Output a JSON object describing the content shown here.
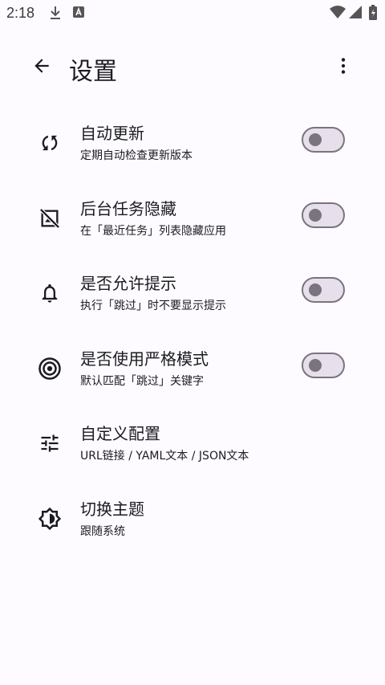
{
  "status_bar": {
    "time": "2:18",
    "icons": [
      "download-icon",
      "app-notification-icon",
      "wifi-icon",
      "signal-icon",
      "battery-icon"
    ]
  },
  "app_bar": {
    "title": "设置",
    "back_icon": "arrow-back-icon",
    "menu_icon": "more-vert-icon"
  },
  "settings": [
    {
      "title": "自动更新",
      "subtitle": "定期自动检查更新版本",
      "icon": "sync-icon",
      "toggle": false
    },
    {
      "title": "后台任务隐藏",
      "subtitle": "在「最近任务」列表隐藏应用",
      "icon": "hide-image-icon",
      "toggle": false
    },
    {
      "title": "是否允许提示",
      "subtitle": "执行「跳过」时不要显示提示",
      "icon": "bell-icon",
      "toggle": false
    },
    {
      "title": "是否使用严格模式",
      "subtitle": "默认匹配「跳过」关键字",
      "icon": "target-icon",
      "toggle": false
    },
    {
      "title": "自定义配置",
      "subtitle": "URL链接 / YAML文本 / JSON文本",
      "icon": "tune-icon"
    },
    {
      "title": "切换主题",
      "subtitle": "跟随系统",
      "icon": "brightness-icon"
    }
  ],
  "colors": {
    "background": "#fdfbff",
    "toggle_track": "#e7e0ec",
    "toggle_outline": "#79747e",
    "text": "#1c1b1f"
  }
}
